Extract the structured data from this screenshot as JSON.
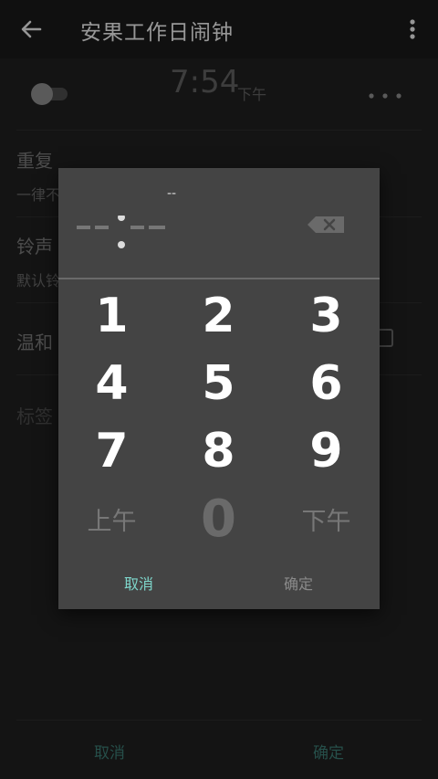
{
  "appbar": {
    "title": "安果工作日闹钟",
    "back_icon": "arrow-left-icon",
    "menu_icon": "more-vert-icon"
  },
  "alarm": {
    "time": "7:54",
    "ampm": "下午",
    "enabled": false
  },
  "settings": {
    "repeat_label": "重复",
    "repeat_value_partial": "一律不",
    "ringtone_label": "铃声",
    "ringtone_value_partial": "默认铃",
    "gentle_label": "温和",
    "tag_label": "标签"
  },
  "bottom_bar": {
    "cancel": "取消",
    "ok": "确定"
  },
  "time_picker": {
    "ampm_indicator": "--",
    "display_placeholder": "--:--",
    "keys": [
      "1",
      "2",
      "3",
      "4",
      "5",
      "6",
      "7",
      "8",
      "9"
    ],
    "am_key": "上午",
    "zero_key": "0",
    "pm_key": "下午",
    "cancel": "取消",
    "ok": "确定",
    "colors": {
      "accent": "#7ed6cb",
      "background": "#444444"
    }
  }
}
